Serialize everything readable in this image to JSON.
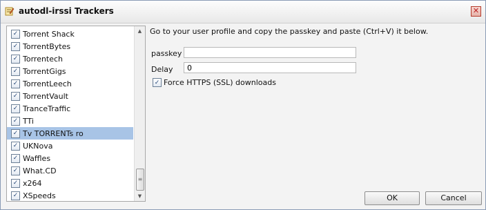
{
  "window": {
    "title": "autodl-irssi Trackers",
    "close_glyph": "✕"
  },
  "trackers": [
    {
      "label": "Torrent Shack",
      "checked": true
    },
    {
      "label": "TorrentBytes",
      "checked": true
    },
    {
      "label": "Torrentech",
      "checked": true
    },
    {
      "label": "TorrentGigs",
      "checked": true
    },
    {
      "label": "TorrentLeech",
      "checked": true
    },
    {
      "label": "TorrentVault",
      "checked": true
    },
    {
      "label": "TranceTraffic",
      "checked": true
    },
    {
      "label": "TTi",
      "checked": true
    },
    {
      "label": "Tv TORRENTs ro",
      "checked": true,
      "selected": true
    },
    {
      "label": "UKNova",
      "checked": true
    },
    {
      "label": "Waffles",
      "checked": true
    },
    {
      "label": "What.CD",
      "checked": true
    },
    {
      "label": "x264",
      "checked": true
    },
    {
      "label": "XSpeeds",
      "checked": true
    }
  ],
  "settings": {
    "instruction": "Go to your user profile and copy the passkey and paste (Ctrl+V) it below.",
    "passkey_label": "passkey",
    "passkey_value": "",
    "delay_label": "Delay",
    "delay_value": "0",
    "force_https_label": "Force HTTPS (SSL) downloads",
    "force_https_checked": true
  },
  "buttons": {
    "ok": "OK",
    "cancel": "Cancel"
  },
  "glyphs": {
    "check": "✓",
    "scroll_up": "▲",
    "scroll_down": "▼",
    "grip": "≡"
  },
  "colors": {
    "selection": "#a8c4e6",
    "border": "#8a9bb5"
  }
}
